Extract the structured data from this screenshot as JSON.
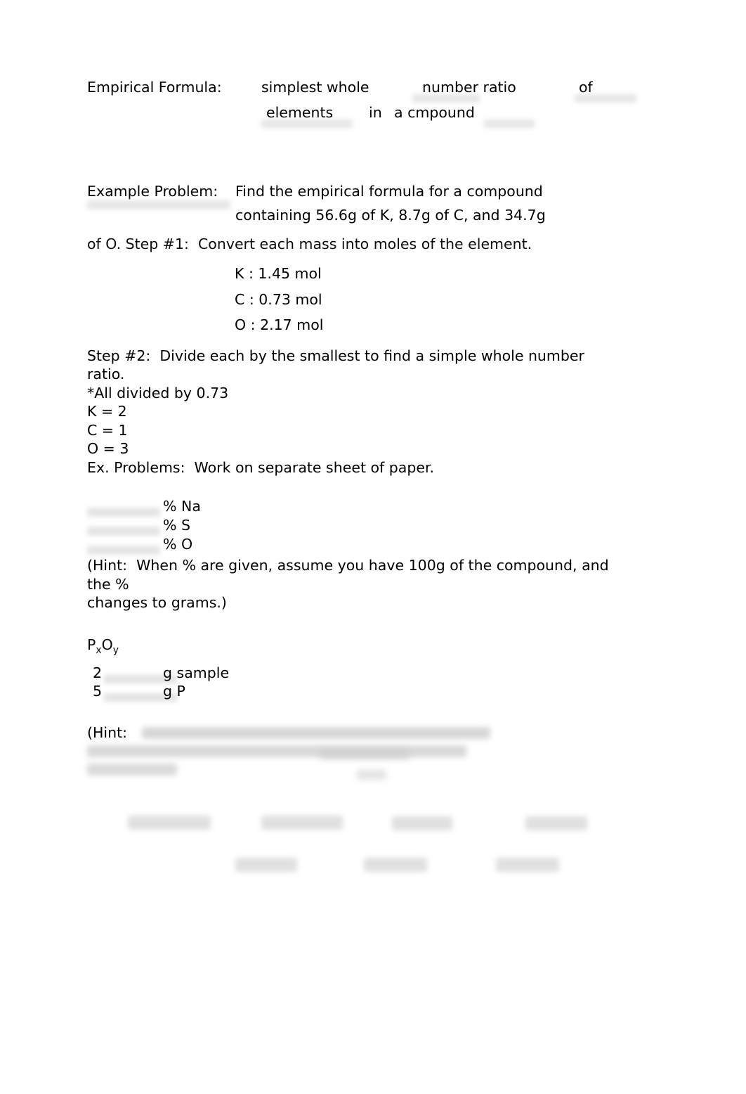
{
  "document": {
    "title": "Empirical Formula notes worksheet",
    "background_color": "#ffffff",
    "text_color": "#0d0d0d"
  },
  "definition": {
    "term": "Empirical Formula:",
    "fill_1": "simplest whole",
    "fill_2": "number ratio",
    "connector_of": "of",
    "fill_3": "elements",
    "connector_in": "in",
    "fill_4": "a cmpound"
  },
  "example": {
    "label": "Example Problem:",
    "line_1": "Find the empirical formula for a compound",
    "line_2": "containing 56.6g of K, 8.7g of C, and 34.7g",
    "line_3": "of O. Step #1:  Convert each mass into moles of the element.",
    "moles": [
      "K : 1.45 mol",
      "C : 0.73 mol",
      "O : 2.17 mol"
    ]
  },
  "step2": {
    "line_1": "Step #2:  Divide each by the smallest to find a simple whole number",
    "line_2": "ratio.",
    "divisor_note": "*All divided by 0.73",
    "results": [
      "K = 2",
      "C = 1",
      "O = 3"
    ]
  },
  "practice": {
    "heading": "Ex. Problems:  Work on separate sheet of paper.",
    "percent_rows": [
      {
        "value": "",
        "label": "% Na"
      },
      {
        "value": "",
        "label": "% S"
      },
      {
        "value": "",
        "label": "% O"
      }
    ],
    "hint_1_line_1": "(Hint:  When % are given, assume you have 100g of the compound, and",
    "hint_1_line_2": "the %",
    "hint_1_line_3": "changes to grams.)",
    "formula": {
      "element_1": "P",
      "subscript_1": "x",
      "element_2": "O",
      "subscript_2": "y"
    },
    "mass_rows": [
      {
        "value": "2",
        "unit": "g sample"
      },
      {
        "value": "5",
        "unit": "g P"
      }
    ],
    "hint_2_label": "(Hint:",
    "hint_2_body": ""
  },
  "bottom_block": {
    "title": "",
    "subtitle": "",
    "row_1_count": 4,
    "row_2_count": 3
  }
}
